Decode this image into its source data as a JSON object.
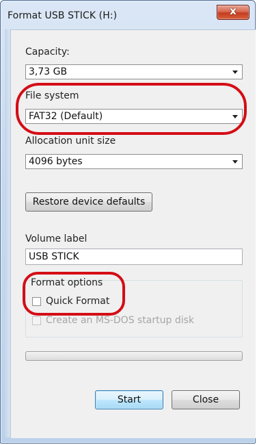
{
  "window": {
    "title": "Format USB STICK (H:)",
    "close_glyph": "x"
  },
  "capacity": {
    "label": "Capacity:",
    "value": "3,73 GB"
  },
  "file_system": {
    "label": "File system",
    "value": "FAT32 (Default)"
  },
  "allocation": {
    "label": "Allocation unit size",
    "value": "4096 bytes"
  },
  "restore_button": "Restore device defaults",
  "volume_label": {
    "label": "Volume label",
    "value": "USB STICK"
  },
  "format_options": {
    "label": "Format options",
    "quick_format": "Quick Format",
    "quick_format_checked": false,
    "msdos_disk": "Create an MS-DOS startup disk",
    "msdos_enabled": false
  },
  "progress": 0,
  "buttons": {
    "start": "Start",
    "close": "Close"
  },
  "colors": {
    "highlight": "#d40d16",
    "accent": "#3c7fb1"
  }
}
